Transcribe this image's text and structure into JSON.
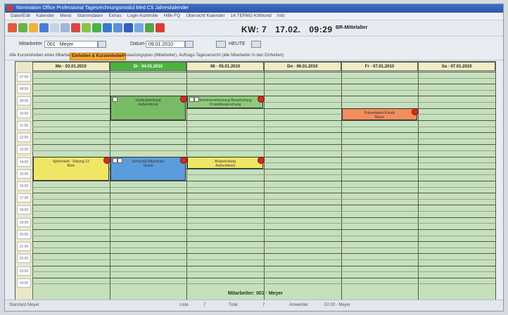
{
  "window": {
    "title": "Nomination Office  Professional  Tagesrechnungsmodul  Med CS  Jahreskalender"
  },
  "menu": [
    "Datei/Edit",
    "Kalender",
    "Menü",
    "Stammdaten",
    "Extras",
    "Login-Kontrolle",
    "Hilfe FQ",
    "Übersicht Kalender",
    "14.TERM2-KWbund",
    "Info"
  ],
  "header": {
    "kw_label": "KW: 7",
    "date": "17.02.",
    "time": "09:29",
    "user": "BR-Mittelalter"
  },
  "filters": {
    "mitarbeiter_label": "Mitarbeiter",
    "mitarbeiter_value": "001 · Meyer",
    "datum_label": "Datum",
    "datum_value": "09.01.2010",
    "heute_label": "HEUTE"
  },
  "tabs": [
    "Alle Kurzeinheiten eines Mitarbeiters",
    "Einheiten & Kurzeinheiten",
    "Auslastungsplan (Mitarbeiter), Auftrags-Tagesansicht (alle Mitarbeiter in den Einheiten)"
  ],
  "days": [
    {
      "label": "Mo · 03.01.2010",
      "today": false
    },
    {
      "label": "Di · 04.01.2010",
      "today": true
    },
    {
      "label": "Mi · 05.01.2010",
      "today": false
    },
    {
      "label": "Do · 06.01.2010",
      "today": false
    },
    {
      "label": "Fr · 07.01.2010",
      "today": false
    },
    {
      "label": "Sa · 07.01.2010",
      "today": false
    }
  ],
  "times": [
    "07:00",
    "08:00",
    "09:00",
    "10:00",
    "11:00",
    "12:00",
    "13:00",
    "14:00",
    "15:00",
    "16:00",
    "17:00",
    "18:00",
    "19:00",
    "20:00",
    "21:00",
    "22:00",
    "23:00",
    "24:00"
  ],
  "appointments": [
    {
      "day": 1,
      "start": 2,
      "end": 4,
      "color": "#77bb66",
      "title": "Vorbesprechung",
      "sub": "Außendienst",
      "checks": 1
    },
    {
      "day": 2,
      "start": 2,
      "end": 3,
      "color": "#8fca7a",
      "title": "Terminvereinbarung Besprechung",
      "sub": "Projektbesprechung",
      "checks": 2
    },
    {
      "day": 4,
      "start": 3,
      "end": 4,
      "color": "#f58c5c",
      "title": "Präsentation Kunde",
      "sub": "Mayer",
      "checks": 0
    },
    {
      "day": 0,
      "start": 7,
      "end": 9,
      "color": "#f0e665",
      "title": "Sprechzeit · Sitzung 13",
      "sub": "Büro",
      "checks": 0
    },
    {
      "day": 1,
      "start": 7,
      "end": 9,
      "color": "#5b9ddc",
      "title": "Schulung Mitarbeiter",
      "sub": "Termin",
      "checks": 2
    },
    {
      "day": 2,
      "start": 7,
      "end": 8,
      "color": "#f0e665",
      "title": "Besprechung",
      "sub": "Außendienst",
      "checks": 0
    }
  ],
  "calendar_footer": "Mitarbeiter: 001 · Meyer",
  "status": {
    "left": "Standard Meyer",
    "termine_label": "Liste",
    "termine_value": "7",
    "total_label": "Total",
    "total_value": "7",
    "user_label": "Anwender",
    "user_value": "02.03 · Meyer"
  },
  "colors": {
    "today_header": "#49b43c",
    "calendar_bg": "#c6dfbd",
    "time_gutter": "#e8e7c9"
  }
}
